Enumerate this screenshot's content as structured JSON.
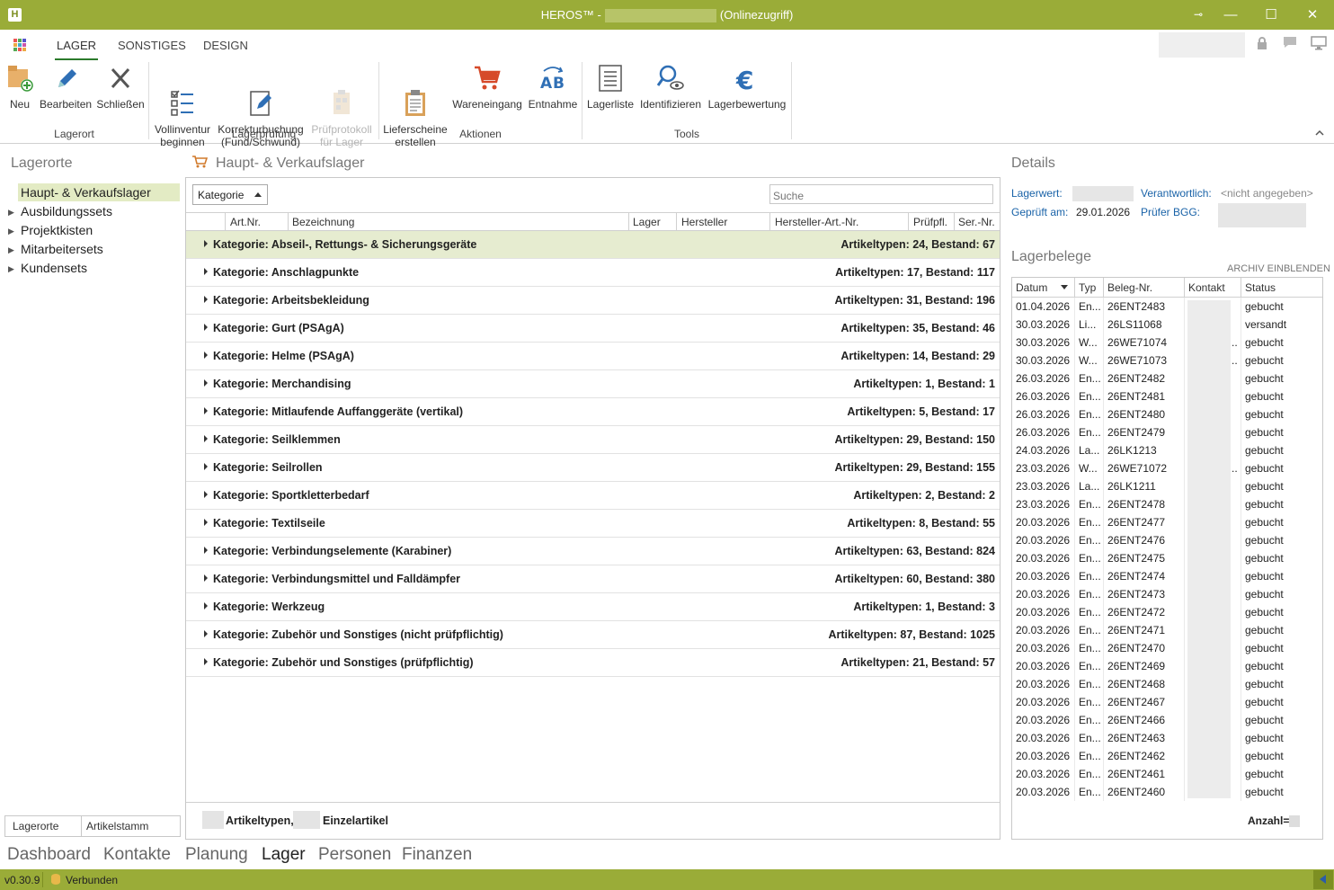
{
  "window": {
    "app_badge": "H",
    "title_prefix": "HEROS™ -",
    "title_suffix": "(Onlinezugriff)",
    "buttons": {
      "pin": "⊸",
      "minimize": "—",
      "maximize": "☐",
      "close": "✕"
    }
  },
  "ribbon_tabs": [
    {
      "label": "LAGER",
      "active": true
    },
    {
      "label": "SONSTIGES",
      "active": false
    },
    {
      "label": "DESIGN",
      "active": false
    }
  ],
  "ribbon": {
    "groups": [
      {
        "label": "Lagerort"
      },
      {
        "label": "Lagerprüfung"
      },
      {
        "label": "Aktionen"
      },
      {
        "label": "Tools"
      }
    ],
    "buttons": [
      {
        "label": "Neu",
        "icon": "new-folder-icon"
      },
      {
        "label": "Bearbeiten",
        "icon": "pencil-icon"
      },
      {
        "label": "Schließen",
        "icon": "close-icon"
      },
      {
        "label": "Vollinventur\nbeginnen",
        "icon": "checklist-icon"
      },
      {
        "label": "Korrekturbuchung\n(Fund/Schwund)",
        "icon": "edit-document-icon"
      },
      {
        "label": "Prüfprotokoll\nfür Lager",
        "icon": "protocol-icon",
        "disabled": true
      },
      {
        "label": "Lieferscheine\nerstellen",
        "icon": "clipboard-icon"
      },
      {
        "label": "Wareneingang",
        "icon": "cart-icon"
      },
      {
        "label": "Entnahme",
        "icon": "ab-icon"
      },
      {
        "label": "Lagerliste",
        "icon": "list-icon"
      },
      {
        "label": "Identifizieren",
        "icon": "search-eye-icon"
      },
      {
        "label": "Lagerbewertung",
        "icon": "euro-icon"
      }
    ]
  },
  "left_panel": {
    "title": "Lagerorte",
    "items": [
      {
        "label": "Haupt- & Verkaufslager",
        "selected": true
      },
      {
        "label": "Ausbildungssets"
      },
      {
        "label": "Projektkisten"
      },
      {
        "label": "Mitarbeitersets"
      },
      {
        "label": "Kundensets"
      }
    ],
    "bottom_tabs": [
      "Lagerorte",
      "Artikelstamm"
    ]
  },
  "center": {
    "title": "Haupt- & Verkaufslager",
    "group_by": "Kategorie",
    "search_placeholder": "Suche",
    "columns": [
      "Art.Nr.",
      "Bezeichnung",
      "Lager",
      "Hersteller",
      "Hersteller-Art.-Nr.",
      "Prüfpfl.",
      "Ser.-Nr."
    ],
    "categories": [
      {
        "name": "Kategorie: Abseil-, Rettungs- & Sicherungsgeräte",
        "stats": "Artikeltypen: 24,  Bestand: 67"
      },
      {
        "name": "Kategorie: Anschlagpunkte",
        "stats": "Artikeltypen: 17,  Bestand: 117"
      },
      {
        "name": "Kategorie: Arbeitsbekleidung",
        "stats": "Artikeltypen: 31,  Bestand: 196"
      },
      {
        "name": "Kategorie: Gurt (PSAgA)",
        "stats": "Artikeltypen: 35,  Bestand: 46"
      },
      {
        "name": "Kategorie: Helme (PSAgA)",
        "stats": "Artikeltypen: 14,  Bestand: 29"
      },
      {
        "name": "Kategorie: Merchandising",
        "stats": "Artikeltypen: 1,  Bestand: 1"
      },
      {
        "name": "Kategorie: Mitlaufende Auffanggeräte (vertikal)",
        "stats": "Artikeltypen: 5,  Bestand: 17"
      },
      {
        "name": "Kategorie: Seilklemmen",
        "stats": "Artikeltypen: 29,  Bestand: 150"
      },
      {
        "name": "Kategorie: Seilrollen",
        "stats": "Artikeltypen: 29,  Bestand: 155"
      },
      {
        "name": "Kategorie: Sportkletterbedarf",
        "stats": "Artikeltypen: 2,  Bestand: 2"
      },
      {
        "name": "Kategorie: Textilseile",
        "stats": "Artikeltypen: 8,  Bestand: 55"
      },
      {
        "name": "Kategorie: Verbindungselemente (Karabiner)",
        "stats": "Artikeltypen: 63,  Bestand: 824"
      },
      {
        "name": "Kategorie: Verbindungsmittel und Falldämpfer",
        "stats": "Artikeltypen: 60,  Bestand: 380"
      },
      {
        "name": "Kategorie: Werkzeug",
        "stats": "Artikeltypen: 1,  Bestand: 3"
      },
      {
        "name": "Kategorie: Zubehör und Sonstiges (nicht prüfpflichtig)",
        "stats": "Artikeltypen: 87,  Bestand: 1025"
      },
      {
        "name": "Kategorie: Zubehör und Sonstiges (prüfpflichtig)",
        "stats": "Artikeltypen: 21,  Bestand: 57"
      }
    ],
    "footer": {
      "artikeltypen": "Artikeltypen,",
      "einzelartikel": "Einzelartikel"
    }
  },
  "details": {
    "title": "Details",
    "lagerwert_label": "Lagerwert:",
    "verantwortlich_label": "Verantwortlich:",
    "verantwortlich_value": "<nicht angegeben>",
    "geprueft_label": "Geprüft am:",
    "geprueft_value": "29.01.2026",
    "pruefer_label": "Prüfer BGG:"
  },
  "belege": {
    "title": "Lagerbelege",
    "archiv_link": "ARCHIV EINBLENDEN",
    "columns": [
      "Datum",
      "Typ",
      "Beleg-Nr.",
      "Kontakt",
      "Status"
    ],
    "rows": [
      [
        "01.04.2026",
        "En...",
        "26ENT2483",
        "",
        "gebucht"
      ],
      [
        "30.03.2026",
        "Li...",
        "26LS11068",
        "",
        "versandt"
      ],
      [
        "30.03.2026",
        "W...",
        "26WE71074",
        "..",
        "gebucht"
      ],
      [
        "30.03.2026",
        "W...",
        "26WE71073",
        "..",
        "gebucht"
      ],
      [
        "26.03.2026",
        "En...",
        "26ENT2482",
        "",
        "gebucht"
      ],
      [
        "26.03.2026",
        "En...",
        "26ENT2481",
        "",
        "gebucht"
      ],
      [
        "26.03.2026",
        "En...",
        "26ENT2480",
        "",
        "gebucht"
      ],
      [
        "26.03.2026",
        "En...",
        "26ENT2479",
        "",
        "gebucht"
      ],
      [
        "24.03.2026",
        "La...",
        "26LK1213",
        "",
        "gebucht"
      ],
      [
        "23.03.2026",
        "W...",
        "26WE71072",
        "..",
        "gebucht"
      ],
      [
        "23.03.2026",
        "La...",
        "26LK1211",
        "",
        "gebucht"
      ],
      [
        "23.03.2026",
        "En...",
        "26ENT2478",
        "",
        "gebucht"
      ],
      [
        "20.03.2026",
        "En...",
        "26ENT2477",
        "",
        "gebucht"
      ],
      [
        "20.03.2026",
        "En...",
        "26ENT2476",
        "",
        "gebucht"
      ],
      [
        "20.03.2026",
        "En...",
        "26ENT2475",
        "",
        "gebucht"
      ],
      [
        "20.03.2026",
        "En...",
        "26ENT2474",
        "",
        "gebucht"
      ],
      [
        "20.03.2026",
        "En...",
        "26ENT2473",
        "",
        "gebucht"
      ],
      [
        "20.03.2026",
        "En...",
        "26ENT2472",
        "",
        "gebucht"
      ],
      [
        "20.03.2026",
        "En...",
        "26ENT2471",
        "",
        "gebucht"
      ],
      [
        "20.03.2026",
        "En...",
        "26ENT2470",
        "",
        "gebucht"
      ],
      [
        "20.03.2026",
        "En...",
        "26ENT2469",
        "",
        "gebucht"
      ],
      [
        "20.03.2026",
        "En...",
        "26ENT2468",
        "",
        "gebucht"
      ],
      [
        "20.03.2026",
        "En...",
        "26ENT2467",
        "",
        "gebucht"
      ],
      [
        "20.03.2026",
        "En...",
        "26ENT2466",
        "",
        "gebucht"
      ],
      [
        "20.03.2026",
        "En...",
        "26ENT2463",
        "",
        "gebucht"
      ],
      [
        "20.03.2026",
        "En...",
        "26ENT2462",
        "",
        "gebucht"
      ],
      [
        "20.03.2026",
        "En...",
        "26ENT2461",
        "",
        "gebucht"
      ],
      [
        "20.03.2026",
        "En...",
        "26ENT2460",
        "",
        "gebucht"
      ]
    ],
    "anzahl_label": "Anzahl="
  },
  "nav": [
    {
      "label": "Dashboard"
    },
    {
      "label": "Kontakte"
    },
    {
      "label": "Planung"
    },
    {
      "label": "Lager",
      "active": true
    },
    {
      "label": "Personen"
    },
    {
      "label": "Finanzen"
    }
  ],
  "status": {
    "version": "v0.30.9",
    "connection": "Verbunden"
  },
  "colors": {
    "accent": "#9aac38",
    "selection": "#e3ebc4",
    "link": "#1a63a8"
  }
}
